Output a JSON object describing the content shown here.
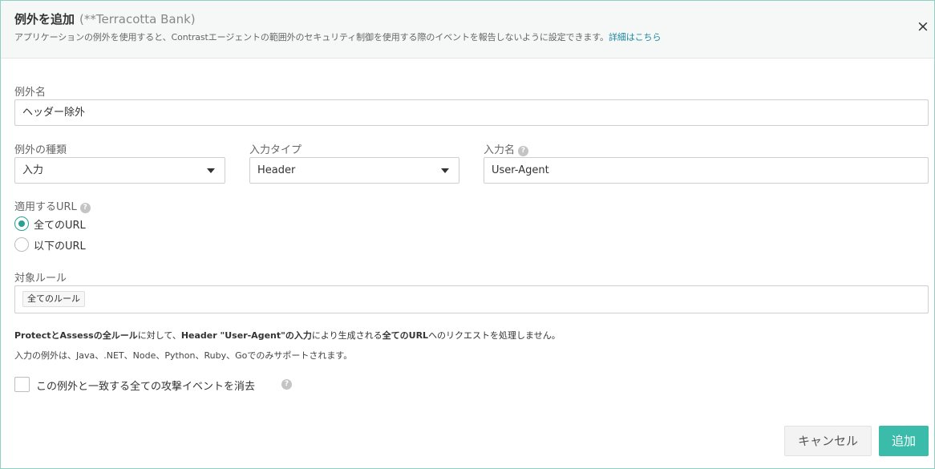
{
  "header": {
    "title": "例外を追加",
    "app_name": "(**Terracotta Bank)",
    "description": "アプリケーションの例外を使用すると、Contrastエージェントの範囲外のセキュリティ制御を使用する際のイベントを報告しないように設定できます。",
    "details_link": "詳細はこちら",
    "close_glyph": "×"
  },
  "form": {
    "exception_name": {
      "label": "例外名",
      "value": "ヘッダー除外"
    },
    "exception_type": {
      "label": "例外の種類",
      "value": "入力"
    },
    "input_type": {
      "label": "入力タイプ",
      "value": "Header"
    },
    "input_name": {
      "label": "入力名",
      "value": "User-Agent"
    },
    "applicable_url": {
      "label": "適用するURL",
      "options": [
        {
          "label": "全てのURL",
          "checked": true
        },
        {
          "label": "以下のURL",
          "checked": false
        }
      ]
    },
    "target_rules": {
      "label": "対象ルール",
      "tags": [
        "全てのルール"
      ]
    },
    "help_glyph": "?"
  },
  "summary": {
    "p1": "ProtectとAssessの全ルール",
    "p2": "に対して、",
    "p3": "Header \"User-Agent\"の入力",
    "p4": "により生成される",
    "p5": "全てのURL",
    "p6": "へのリクエストを処理しません。"
  },
  "note": "入力の例外は、Java、.NET、Node、Python、Ruby、Goでのみサポートされます。",
  "purge_checkbox": {
    "label": "この例外と一致する全ての攻撃イベントを消去",
    "checked": false
  },
  "buttons": {
    "cancel": "キャンセル",
    "add": "追加"
  },
  "colors": {
    "accent": "#3bbcab",
    "link": "#1d8aa0",
    "radio_checked": "#2aa092"
  }
}
